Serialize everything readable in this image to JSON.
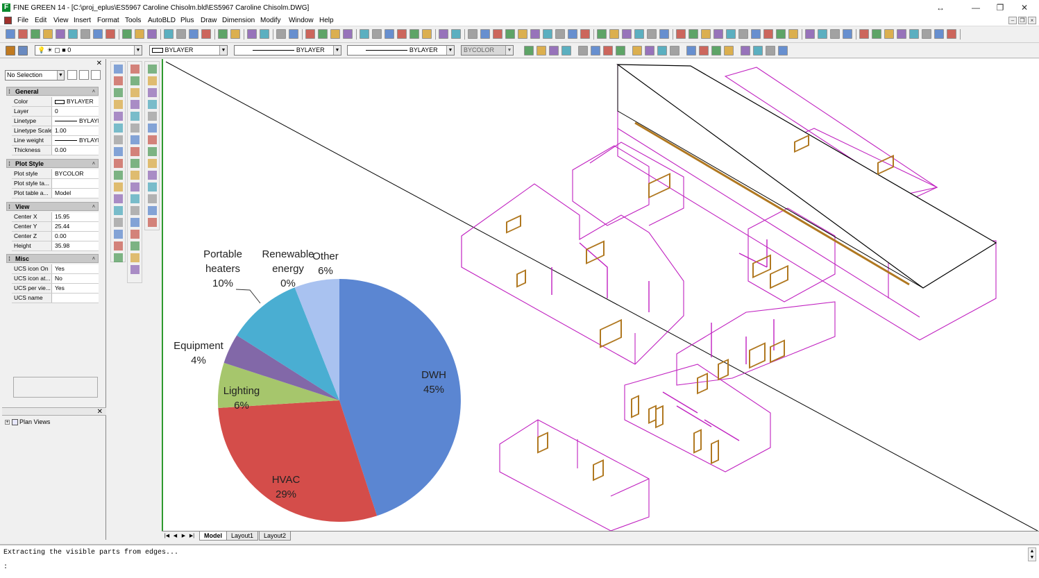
{
  "window": {
    "title": "FINE GREEN 14  - [C:\\proj_eplus\\ES5967 Caroline Chisolm.bld\\ES5967 Caroline Chisolm.DWG]",
    "app_icon": "F",
    "controls": [
      "↔",
      "—",
      "❐",
      "✕"
    ]
  },
  "menu": {
    "items": [
      "File",
      "Edit",
      "View",
      "Insert",
      "Format",
      "Tools",
      "AutoBLD",
      "Plus",
      "Draw",
      "Dimension",
      "Modify",
      "Window",
      "Help"
    ],
    "mdi_controls": [
      "–",
      "❐",
      "×"
    ]
  },
  "toolbar2": {
    "layer_value": "0",
    "color_value": "BYLAYER",
    "linetype_value": "BYLAYER",
    "lineweight_value": "BYLAYER",
    "plotstyle_value": "BYCOLOR"
  },
  "properties": {
    "selection": "No Selection",
    "sections": [
      {
        "title": "General",
        "rows": [
          {
            "name": "Color",
            "value": "BYLAYER"
          },
          {
            "name": "Layer",
            "value": "0"
          },
          {
            "name": "Linetype",
            "value": "BYLAYE"
          },
          {
            "name": "Linetype Scale",
            "value": "1.00"
          },
          {
            "name": "Line weight",
            "value": "BYLAYE"
          },
          {
            "name": "Thickness",
            "value": "0.00"
          }
        ]
      },
      {
        "title": "Plot Style",
        "rows": [
          {
            "name": "Plot style",
            "value": "BYCOLOR"
          },
          {
            "name": "Plot style ta...",
            "value": ""
          },
          {
            "name": "Plot table a...",
            "value": "Model"
          }
        ]
      },
      {
        "title": "View",
        "rows": [
          {
            "name": "Center X",
            "value": "15.95"
          },
          {
            "name": "Center Y",
            "value": "25.44"
          },
          {
            "name": "Center Z",
            "value": "0.00"
          },
          {
            "name": "Height",
            "value": "35.98"
          }
        ]
      },
      {
        "title": "Misc",
        "rows": [
          {
            "name": "UCS icon On",
            "value": "Yes"
          },
          {
            "name": "UCS icon at...",
            "value": "No"
          },
          {
            "name": "UCS per vie...",
            "value": "Yes"
          },
          {
            "name": "UCS name",
            "value": ""
          }
        ]
      }
    ]
  },
  "tree": {
    "item": "Plan Views"
  },
  "layout_tabs": [
    "Model",
    "Layout1",
    "Layout2"
  ],
  "command": {
    "history": "Extracting the visible parts from edges...",
    "prompt": ":"
  },
  "chart_data": {
    "type": "pie",
    "slices": [
      {
        "label": "DWH",
        "value": 45,
        "display": "45%",
        "color": "#5b86d2"
      },
      {
        "label": "HVAC",
        "value": 29,
        "display": "29%",
        "color": "#d44d4a"
      },
      {
        "label": "Lighting",
        "value": 6,
        "display": "6%",
        "color": "#a6c66c"
      },
      {
        "label": "Equipment",
        "value": 4,
        "display": "4%",
        "color": "#8268a8"
      },
      {
        "label": "Portable heaters",
        "value": 10,
        "display": "10%",
        "color": "#4aaed2"
      },
      {
        "label": "Renewable energy",
        "value": 0,
        "display": "0%",
        "color": "#b89fd4"
      },
      {
        "label": "Other",
        "value": 6,
        "display": "6%",
        "color": "#a9c2f0"
      }
    ]
  },
  "colors": {
    "canvas_border": "#2e9a2e",
    "building_walls": "#c020c0",
    "window_frames": "#b07820"
  }
}
